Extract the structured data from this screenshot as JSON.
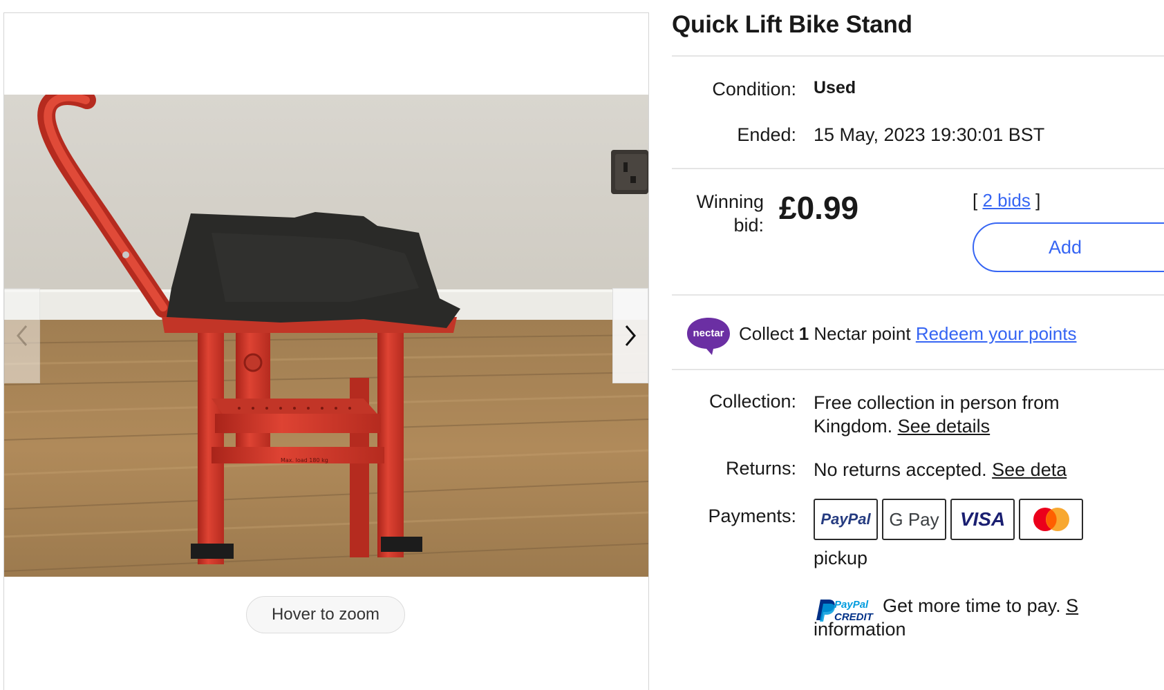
{
  "photo": {
    "zoom_hint": "Hover to zoom",
    "stand_label": "Max. load 180 kg"
  },
  "listing": {
    "title": "Quick Lift Bike Stand",
    "condition_label": "Condition:",
    "condition_value": "Used",
    "ended_label": "Ended:",
    "ended_value": "15 May, 2023 19:30:01 BST",
    "winning_label_line1": "Winning",
    "winning_label_line2": "bid:",
    "price": "£0.99",
    "bids_open": "[",
    "bids_link": "2 bids",
    "bids_close": "]",
    "watch_button": "Add"
  },
  "nectar": {
    "logo_text": "nectar",
    "collect_prefix": "Collect ",
    "collect_count": "1",
    "collect_suffix": " Nectar point ",
    "redeem_link": "Redeem your points"
  },
  "shipping": {
    "collection_label": "Collection:",
    "collection_line1": "Free collection in person from ",
    "collection_line2": "Kingdom. ",
    "collection_link": "See details",
    "returns_label": "Returns:",
    "returns_value": "No returns accepted. ",
    "returns_link": "See deta",
    "payments_label": "Payments:",
    "payment_methods": [
      "PayPal",
      "G Pay",
      "VISA",
      "Mastercard"
    ],
    "pickup_text": "pickup",
    "paypal_credit_line1": "PayPal",
    "paypal_credit_line2": "CREDIT",
    "paypal_credit_text": "Get more time to pay. ",
    "paypal_credit_link": "S",
    "paypal_credit_line_b": "information"
  },
  "colors": {
    "link_blue": "#3665f3",
    "nectar_purple": "#6b2fa3",
    "stand_red": "#d43a2c"
  }
}
